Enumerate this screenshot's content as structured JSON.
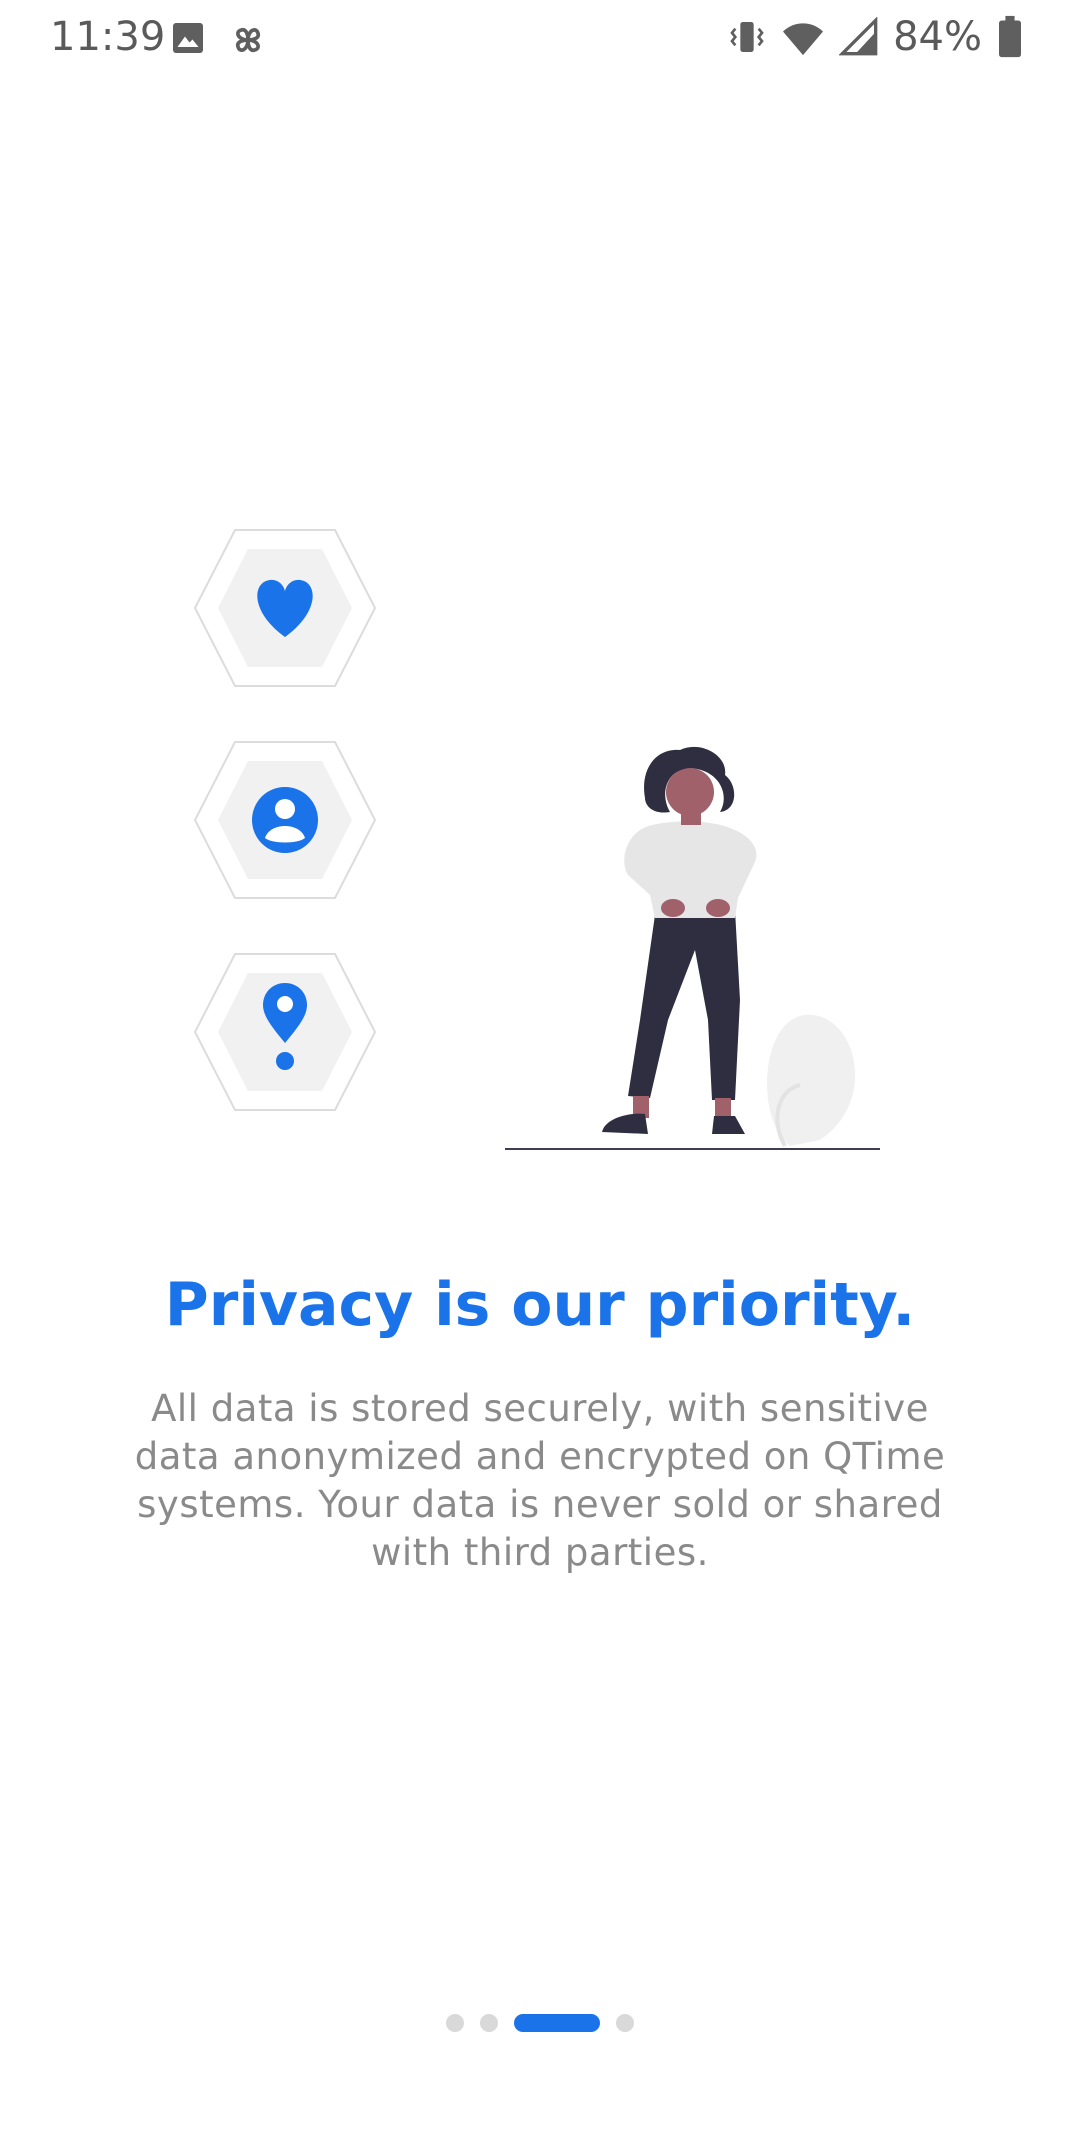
{
  "status_bar": {
    "time": "11:39",
    "battery_percent": "84%",
    "icons": [
      "image-icon",
      "pinwheel-icon",
      "vibrate-icon",
      "wifi-icon",
      "signal-icon",
      "battery-icon"
    ]
  },
  "illustration": {
    "hex_icons": [
      "heart-icon",
      "account-icon",
      "location-pin-icon"
    ],
    "accent_color": "#1a73e8"
  },
  "onboarding": {
    "title": "Privacy is our priority.",
    "description": "All data is stored securely, with sensitive data anonymized and encrypted on QTime systems. Your data is never sold or shared with third parties."
  },
  "pager": {
    "total_pages": 4,
    "active_index": 2
  },
  "colors": {
    "accent": "#1a73e8",
    "text_secondary": "#8a8a8a",
    "dot_inactive": "#d9d9d9"
  }
}
